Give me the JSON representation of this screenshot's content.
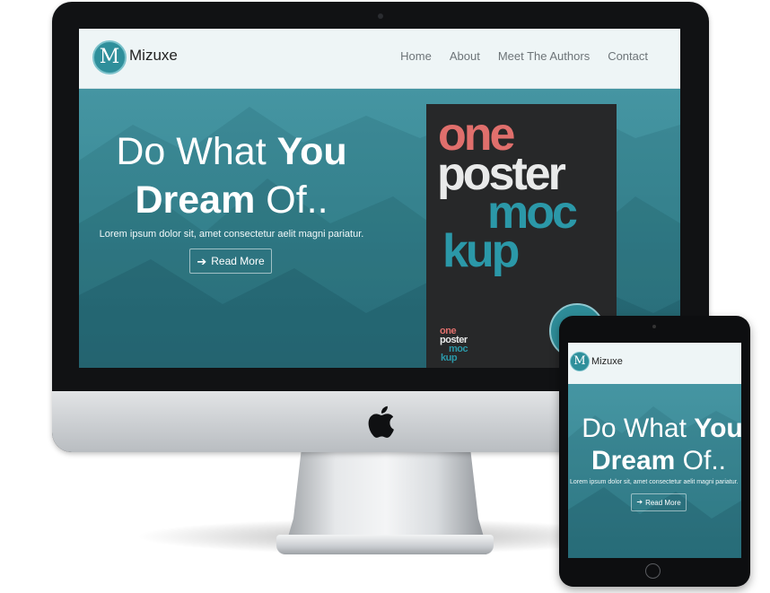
{
  "site": {
    "logo_letter": "M",
    "brand": "Mizuxe",
    "nav": [
      "Home",
      "About",
      "Meet The Authors",
      "Contact"
    ]
  },
  "hero": {
    "line1_light": "Do What ",
    "line1_bold": "You",
    "line2_bold": "Dream",
    "line2_light": " Of..",
    "subtitle": "Lorem ipsum dolor sit, amet consectetur aelit magni pariatur.",
    "button_label": "Read More",
    "button_icon": "arrow-right-icon"
  },
  "poster": {
    "words": [
      "one",
      "poster",
      "moc",
      "kup"
    ]
  },
  "colors": {
    "accent": "#2f8f9b",
    "hero_overlay": "#3b8a96",
    "nav_bg": "#eef5f6",
    "poster_bg": "#272829",
    "poster_red": "#e06f6c",
    "poster_teal": "#2b98a8"
  }
}
